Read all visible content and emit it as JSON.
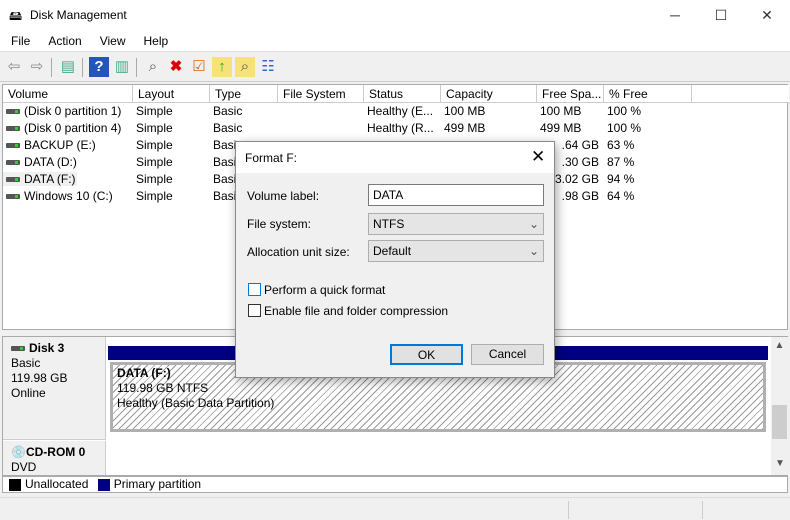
{
  "window": {
    "title": "Disk Management",
    "minimize": "─",
    "maximize": "☐",
    "close": "✕"
  },
  "menu": [
    "File",
    "Action",
    "View",
    "Help"
  ],
  "columns": [
    "Volume",
    "Layout",
    "Type",
    "File System",
    "Status",
    "Capacity",
    "Free Spa...",
    "% Free"
  ],
  "volumes": [
    {
      "volume": "(Disk 0 partition 1)",
      "layout": "Simple",
      "type": "Basic",
      "fs": "",
      "status": "Healthy (E...",
      "capacity": "100 MB",
      "free": "100 MB",
      "pct": "100 %"
    },
    {
      "volume": "(Disk 0 partition 4)",
      "layout": "Simple",
      "type": "Basic",
      "fs": "",
      "status": "Healthy (R...",
      "capacity": "499 MB",
      "free": "499 MB",
      "pct": "100 %"
    },
    {
      "volume": "BACKUP (E:)",
      "layout": "Simple",
      "type": "Basic",
      "fs": "",
      "status": "",
      "capacity": "",
      "free": ".64 GB",
      "pct": "63 %"
    },
    {
      "volume": "DATA (D:)",
      "layout": "Simple",
      "type": "Basic",
      "fs": "",
      "status": "",
      "capacity": "",
      "free": ".30 GB",
      "pct": "87 %"
    },
    {
      "volume": "DATA (F:)",
      "layout": "Simple",
      "type": "Basic",
      "fs": "",
      "status": "",
      "capacity": "",
      "free": "3.02 GB",
      "pct": "94 %"
    },
    {
      "volume": "Windows 10 (C:)",
      "layout": "Simple",
      "type": "Basic",
      "fs": "",
      "status": "",
      "capacity": "",
      "free": ".98 GB",
      "pct": "64 %"
    }
  ],
  "disks": [
    {
      "name": "Disk 3",
      "kind": "Basic",
      "size": "119.98 GB",
      "state": "Online",
      "partition": {
        "name": "DATA  (F:)",
        "size": "119.98 GB NTFS",
        "status": "Healthy (Basic Data Partition)"
      }
    },
    {
      "name": "CD-ROM 0",
      "kind": "DVD"
    }
  ],
  "legend": [
    {
      "label": "Unallocated",
      "color": "#000000"
    },
    {
      "label": "Primary partition",
      "color": "#000080"
    }
  ],
  "dialog": {
    "title": "Format F:",
    "volume_label": "Volume label:",
    "volume_value": "DATA",
    "fs_label": "File system:",
    "fs_value": "NTFS",
    "alloc_label": "Allocation unit size:",
    "alloc_value": "Default",
    "quick_format": "Perform a quick format",
    "quick_checked": false,
    "compression": "Enable file and folder compression",
    "compression_checked": false,
    "ok": "OK",
    "cancel": "Cancel"
  },
  "colors": {
    "primary_partition": "#000080",
    "accent": "#0078d7"
  }
}
